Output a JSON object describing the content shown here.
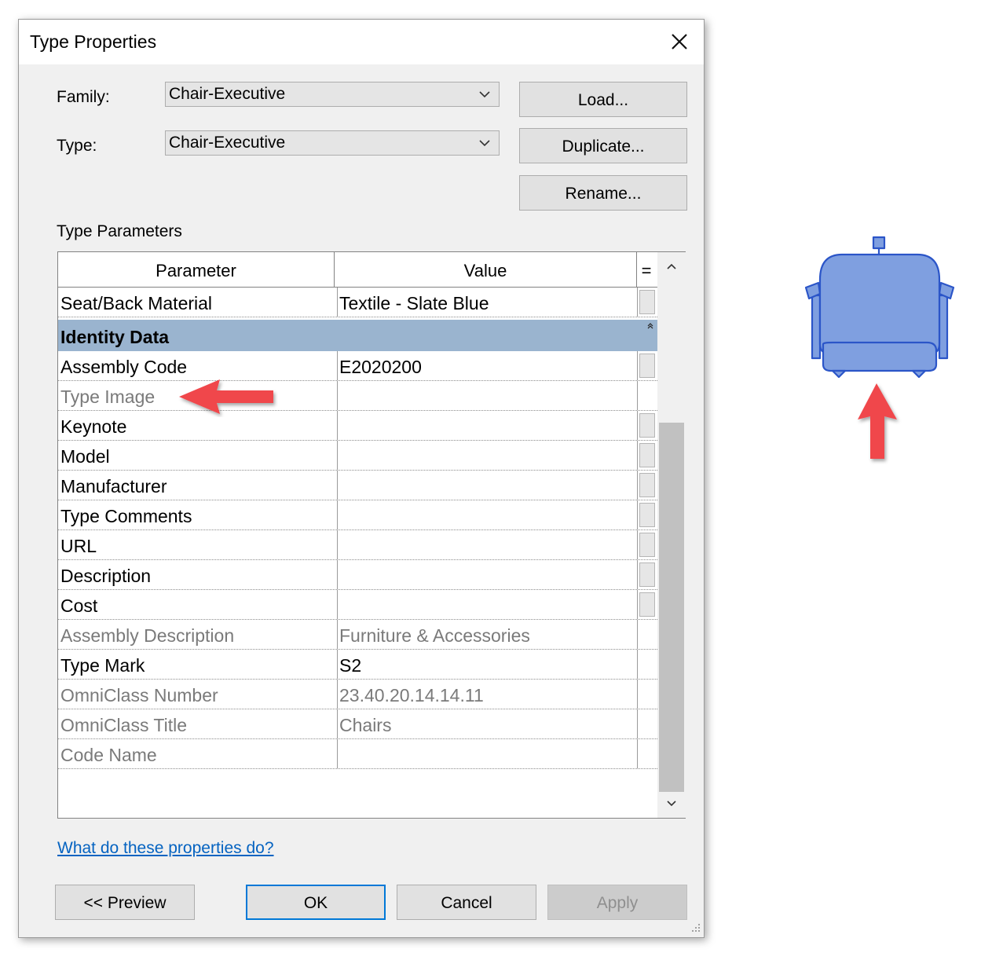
{
  "dialog": {
    "title": "Type Properties",
    "family_label": "Family:",
    "family_value": "Chair-Executive",
    "type_label": "Type:",
    "type_value": "Chair-Executive",
    "buttons": {
      "load": "Load...",
      "duplicate": "Duplicate...",
      "rename": "Rename..."
    },
    "type_parameters_label": "Type Parameters",
    "table": {
      "headers": {
        "parameter": "Parameter",
        "value": "Value",
        "eq": "="
      },
      "rows_top": [
        {
          "parameter": "Seat/Back Material",
          "value": "Textile - Slate Blue",
          "readonly": false,
          "eq_button": true
        }
      ],
      "group": {
        "title": "Identity Data",
        "collapse_glyph": "⌃"
      },
      "rows": [
        {
          "parameter": "Assembly Code",
          "value": "E2020200",
          "readonly": false,
          "eq_button": true
        },
        {
          "parameter": "Type Image",
          "value": "",
          "readonly": true,
          "eq_button": false
        },
        {
          "parameter": "Keynote",
          "value": "",
          "readonly": false,
          "eq_button": true
        },
        {
          "parameter": "Model",
          "value": "",
          "readonly": false,
          "eq_button": true
        },
        {
          "parameter": "Manufacturer",
          "value": "",
          "readonly": false,
          "eq_button": true
        },
        {
          "parameter": "Type Comments",
          "value": "",
          "readonly": false,
          "eq_button": true
        },
        {
          "parameter": "URL",
          "value": "",
          "readonly": false,
          "eq_button": true
        },
        {
          "parameter": "Description",
          "value": "",
          "readonly": false,
          "eq_button": true
        },
        {
          "parameter": "Cost",
          "value": "",
          "readonly": false,
          "eq_button": true
        },
        {
          "parameter": "Assembly Description",
          "value": "Furniture & Accessories",
          "readonly": true,
          "eq_button": false
        },
        {
          "parameter": "Type Mark",
          "value": "S2",
          "readonly": false,
          "eq_button": false
        },
        {
          "parameter": "OmniClass Number",
          "value": "23.40.20.14.14.11",
          "readonly": true,
          "eq_button": false
        },
        {
          "parameter": "OmniClass Title",
          "value": "Chairs",
          "readonly": true,
          "eq_button": false
        },
        {
          "parameter": "Code Name",
          "value": "",
          "readonly": true,
          "eq_button": false
        }
      ]
    },
    "help_link": "What do these properties do?",
    "footer": {
      "preview": "<< Preview",
      "ok": "OK",
      "cancel": "Cancel",
      "apply": "Apply"
    }
  },
  "colors": {
    "group_header_bg": "#9ab4cf",
    "annotation_arrow": "#f0464b",
    "chair_fill": "#7f9fe0",
    "chair_stroke": "#2b55c8",
    "link": "#0563c1",
    "ok_border": "#0078d7"
  },
  "icons": {
    "close": "close-icon",
    "dropdown": "chevron-down-icon",
    "scroll_up": "chevron-up-icon",
    "scroll_down": "chevron-down-icon",
    "chair_preview": "chair-plan-icon"
  }
}
